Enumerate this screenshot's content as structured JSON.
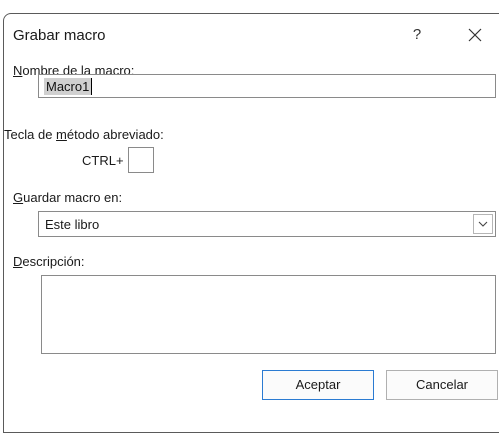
{
  "dialog": {
    "title": "Grabar macro",
    "help_label": "?",
    "close_icon": "close-icon"
  },
  "macro_name": {
    "label_accel": "N",
    "label_rest": "ombre de la macro:",
    "value": "Macro1"
  },
  "shortcut": {
    "label_pre": "Tecla de ",
    "label_accel": "m",
    "label_post": "étodo abreviado:",
    "prefix": "CTRL+",
    "value": ""
  },
  "store_in": {
    "label_accel": "G",
    "label_rest": "uardar macro en:",
    "selected": "Este libro",
    "dropdown_icon": "chevron-down-icon"
  },
  "description": {
    "label_accel": "D",
    "label_rest": "escripción:",
    "value": ""
  },
  "buttons": {
    "ok": "Aceptar",
    "cancel": "Cancelar"
  },
  "colors": {
    "ok_border": "#2b7bd2",
    "selection": "#d0d0d0"
  }
}
